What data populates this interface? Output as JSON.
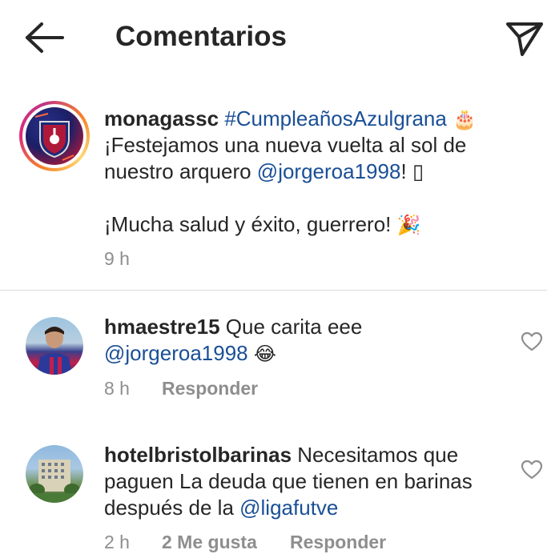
{
  "header": {
    "title": "Comentarios",
    "back_icon": "arrow-left-icon",
    "send_icon": "paper-plane-icon"
  },
  "caption": {
    "username": "monagassc",
    "hashtag": "#CumpleañosAzulgrana",
    "emoji_cake": "🎂",
    "line1": "¡Festejamos una nueva vuelta al sol de",
    "line2_prefix": "nuestro arquero ",
    "mention": "@jorgeroa1998",
    "line2_suffix": "! ",
    "missing_glyph": "▯",
    "line3": "¡Mucha salud y éxito, guerrero! ",
    "emoji_party": "🎉",
    "time": "9 h"
  },
  "comments": [
    {
      "username": "hmaestre15",
      "text": " Que carita eee",
      "mention": "@jorgeroa1998",
      "emoji": "😂",
      "time": "8 h",
      "reply_label": "Responder"
    },
    {
      "username": "hotelbristolbarinas",
      "text": " Necesitamos que",
      "line2": "paguen La deuda que tienen en barinas",
      "line3_prefix": "después de la ",
      "mention": "@ligafutve",
      "time": "2 h",
      "likes_label": "2 Me gusta",
      "reply_label": "Responder"
    }
  ],
  "colors": {
    "text": "#262626",
    "link": "#1a4f96",
    "muted": "#8e8e8e",
    "divider": "#dcdcdc"
  }
}
